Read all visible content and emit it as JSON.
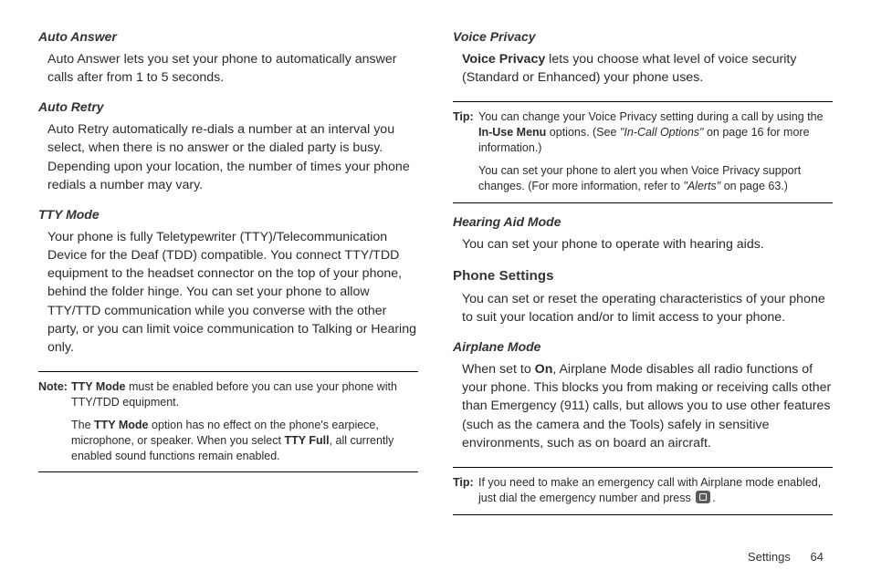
{
  "left": {
    "auto_answer": {
      "head": "Auto Answer",
      "body": "Auto Answer lets you set your phone to automatically answer calls after from 1 to 5 seconds."
    },
    "auto_retry": {
      "head": "Auto Retry",
      "body": "Auto Retry automatically re-dials a number at an interval you select, when there is no answer or the dialed party is busy. Depending upon your location, the number of times your phone redials a number may vary."
    },
    "tty": {
      "head": "TTY Mode",
      "body": "Your phone is fully Teletypewriter (TTY)/Telecommunication Device for the Deaf (TDD) compatible. You connect TTY/TDD equipment to the headset connector on the top of your phone, behind the folder hinge. You can set your phone to allow TTY/TTD communication while you converse with the other party, or you can limit voice communication to Talking or Hearing only."
    },
    "note": {
      "label": "Note:",
      "line1a": "TTY Mode",
      "line1b": " must be enabled before you can use your phone with TTY/TDD equipment.",
      "line2a": "The ",
      "line2b": "TTY Mode",
      "line2c": " option has no effect on the phone's earpiece, microphone, or speaker. When you select ",
      "line2d": "TTY Full",
      "line2e": ", all currently enabled sound functions remain enabled."
    }
  },
  "right": {
    "voice_privacy": {
      "head": "Voice Privacy",
      "body_a": "Voice Privacy",
      "body_b": " lets you choose what level of voice security (Standard or Enhanced) your phone uses."
    },
    "tip1": {
      "label": "Tip:",
      "l1a": "You can change your Voice Privacy setting during a call by using the ",
      "l1b": "In-Use Menu",
      "l1c": " options. (See ",
      "l1d": "\"In-Call Options\"",
      "l1e": " on page 16 for more information.)",
      "l2a": "You can set your phone to alert you when Voice Privacy support changes. (For more information, refer to ",
      "l2b": "\"Alerts\"",
      "l2c": " on page 63.)"
    },
    "hearing": {
      "head": "Hearing Aid Mode",
      "body": "You can set your phone to operate with hearing aids."
    },
    "phone_settings": {
      "head": "Phone Settings",
      "body": "You can set or reset the operating characteristics of your phone to suit your location and/or to limit access to your phone."
    },
    "airplane": {
      "head": "Airplane Mode",
      "body_a": "When set to ",
      "body_b": "On",
      "body_c": ", Airplane Mode disables all radio functions of your phone. This blocks you from making or receiving calls other than Emergency (911) calls, but allows you to use other features (such as the camera and the Tools) safely in sensitive environments, such as on board an aircraft."
    },
    "tip2": {
      "label": "Tip:",
      "l1a": "If you need to make an emergency call with Airplane mode enabled, just dial the emergency number and press ",
      "l1b": "."
    }
  },
  "footer": {
    "section": "Settings",
    "page": "64"
  }
}
